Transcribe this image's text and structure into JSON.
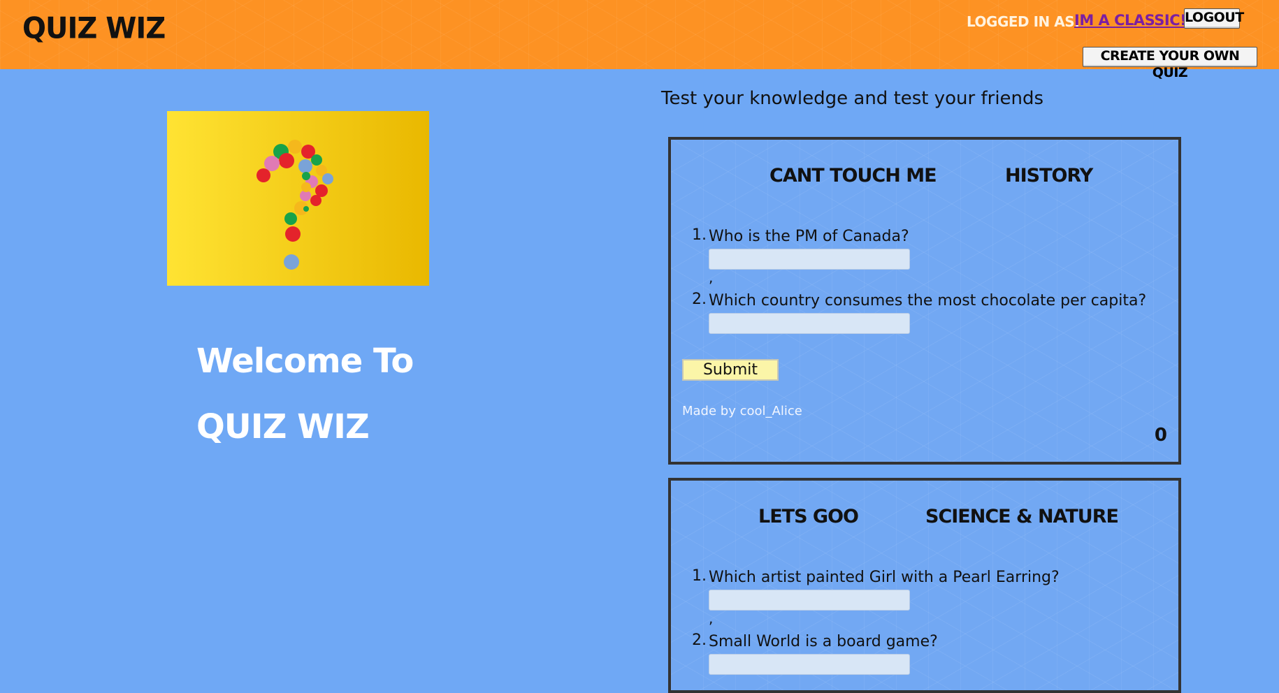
{
  "header": {
    "logo": "QUIZ WIZ",
    "logged_in_label": "LOGGED IN AS:",
    "username": "IM A CLASSIC!",
    "logout_label": "LOGOUT",
    "create_quiz_label": "CREATE YOUR OWN QUIZ"
  },
  "hero": {
    "welcome_line1": "Welcome To",
    "welcome_line2": "QUIZ WIZ"
  },
  "main": {
    "tagline": "Test your knowledge and test your friends"
  },
  "quizzes": [
    {
      "title": "CANT TOUCH ME",
      "category": "HISTORY",
      "questions": [
        {
          "number": "1.",
          "text": "Who is the PM of Canada?",
          "answer": ""
        },
        {
          "number": "2.",
          "text": "Which country consumes the most chocolate per capita?",
          "answer": ""
        }
      ],
      "separator": ",",
      "submit_label": "Submit",
      "author": "Made by cool_Alice",
      "score": "0"
    },
    {
      "title": "LETS GOO",
      "category": "SCIENCE & NATURE",
      "questions": [
        {
          "number": "1.",
          "text": "Which artist painted Girl with a Pearl Earring?",
          "answer": ""
        },
        {
          "number": "2.",
          "text": "Small World is a board game?",
          "answer": ""
        }
      ],
      "separator": ","
    }
  ],
  "colors": {
    "header_bg": "#fd9223",
    "page_bg": "#6fa8f5",
    "card_border": "#333333",
    "submit_bg": "#fbf5a8",
    "username_link": "#7b1fa2"
  }
}
